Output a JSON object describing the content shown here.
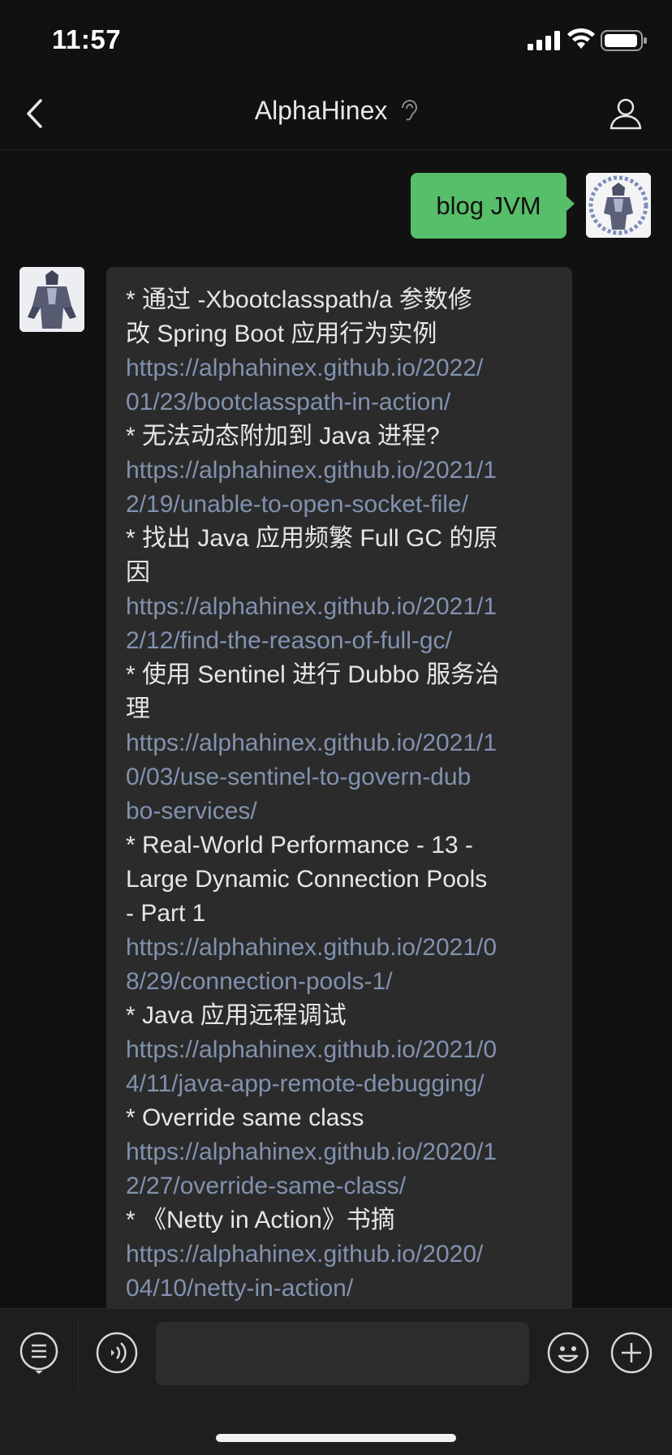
{
  "status_bar": {
    "time": "11:57"
  },
  "header": {
    "title": "AlphaHinex"
  },
  "sent_message": {
    "text": "blog JVM"
  },
  "received_message": {
    "lines": [
      {
        "text": "* 通过 -Xbootclasspath/a 参数修",
        "kind": "title"
      },
      {
        "text": "改 Spring Boot 应用行为实例",
        "kind": "title"
      },
      {
        "text": "https://alphahinex.github.io/2022/",
        "kind": "link"
      },
      {
        "text": "01/23/bootclasspath-in-action/",
        "kind": "link"
      },
      {
        "text": "* 无法动态附加到 Java 进程?",
        "kind": "title"
      },
      {
        "text": "https://alphahinex.github.io/2021/1",
        "kind": "link"
      },
      {
        "text": "2/19/unable-to-open-socket-file/",
        "kind": "link"
      },
      {
        "text": "* 找出 Java 应用频繁 Full GC 的原",
        "kind": "title"
      },
      {
        "text": "因",
        "kind": "title"
      },
      {
        "text": "https://alphahinex.github.io/2021/1",
        "kind": "link"
      },
      {
        "text": "2/12/find-the-reason-of-full-gc/",
        "kind": "link"
      },
      {
        "text": "* 使用 Sentinel 进行 Dubbo 服务治",
        "kind": "title"
      },
      {
        "text": "理",
        "kind": "title"
      },
      {
        "text": "https://alphahinex.github.io/2021/1",
        "kind": "link"
      },
      {
        "text": "0/03/use-sentinel-to-govern-dub",
        "kind": "link"
      },
      {
        "text": "bo-services/",
        "kind": "link"
      },
      {
        "text": "* Real-World Performance - 13 -",
        "kind": "title"
      },
      {
        "text": "Large Dynamic Connection Pools",
        "kind": "title"
      },
      {
        "text": "- Part 1",
        "kind": "title"
      },
      {
        "text": "https://alphahinex.github.io/2021/0",
        "kind": "link"
      },
      {
        "text": "8/29/connection-pools-1/",
        "kind": "link"
      },
      {
        "text": "* Java 应用远程调试",
        "kind": "title"
      },
      {
        "text": "https://alphahinex.github.io/2021/0",
        "kind": "link"
      },
      {
        "text": "4/11/java-app-remote-debugging/",
        "kind": "link"
      },
      {
        "text": "* Override same class",
        "kind": "title"
      },
      {
        "text": "https://alphahinex.github.io/2020/1",
        "kind": "link"
      },
      {
        "text": "2/27/override-same-class/",
        "kind": "link"
      },
      {
        "text": "* 《Netty in Action》书摘",
        "kind": "title"
      },
      {
        "text": "https://alphahinex.github.io/2020/",
        "kind": "link"
      },
      {
        "text": "04/10/netty-in-action/",
        "kind": "link"
      }
    ]
  },
  "colors": {
    "background": "#111111",
    "sent_bubble": "#57be6a",
    "received_bubble": "#2b2b2b",
    "link": "#8192b0"
  },
  "icons": {
    "back": "chevron-left-icon",
    "muted": "ear-muted-icon",
    "profile": "person-icon",
    "menu": "list-menu-icon",
    "voice": "voice-icon",
    "emoji": "emoji-icon",
    "add": "plus-icon"
  }
}
